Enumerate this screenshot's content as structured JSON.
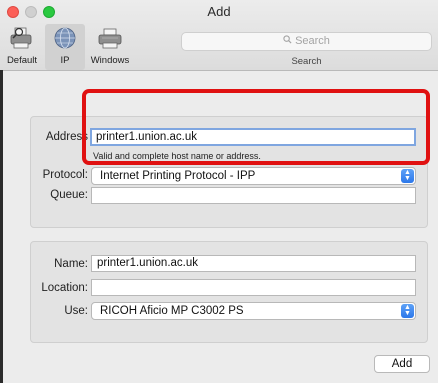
{
  "window": {
    "title": "Add"
  },
  "toolbar": {
    "tabs": [
      {
        "label": "Default",
        "icon": "printer-magnifier-icon"
      },
      {
        "label": "IP",
        "icon": "globe-icon"
      },
      {
        "label": "Windows",
        "icon": "windows-printer-icon"
      }
    ],
    "selected_tab": "IP",
    "search": {
      "placeholder": "Search",
      "caption": "Search"
    }
  },
  "ip_form": {
    "address_label": "Address",
    "address_value": "printer1.union.ac.uk",
    "address_hint": "Valid and complete host name or address.",
    "protocol_label": "Protocol:",
    "protocol_value": "Internet Printing Protocol - IPP",
    "queue_label": "Queue:",
    "queue_value": ""
  },
  "printer_form": {
    "name_label": "Name:",
    "name_value": "printer1.union.ac.uk",
    "location_label": "Location:",
    "location_value": "",
    "use_label": "Use:",
    "use_value": "RICOH Aficio MP C3002 PS"
  },
  "actions": {
    "add_label": "Add"
  },
  "colors": {
    "highlight": "#e01111",
    "focus_ring": "#7fa6e0",
    "select_accent": "#2c77ea",
    "close_button": "#fc5f57",
    "zoom_button": "#2ac940"
  }
}
